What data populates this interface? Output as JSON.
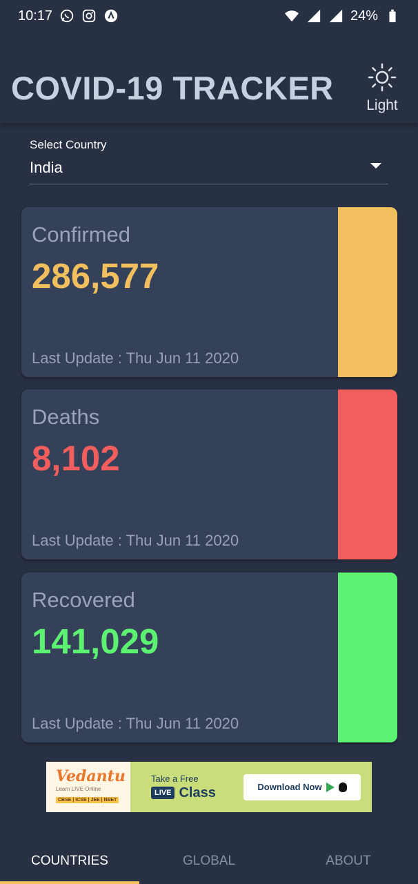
{
  "status_bar": {
    "time": "10:17",
    "battery": "24%",
    "icons_left": [
      "whatsapp-icon",
      "instagram-icon",
      "app-icon"
    ],
    "icons_right": [
      "wifi-icon",
      "signal-icon",
      "signal-roaming-icon",
      "battery-icon"
    ]
  },
  "header": {
    "title": "COVID-19 TRACKER",
    "theme_toggle": {
      "icon": "sun-icon",
      "label": "Light"
    }
  },
  "country_select": {
    "label": "Select Country",
    "value": "India"
  },
  "cards": [
    {
      "title": "Confirmed",
      "value": "286,577",
      "update": "Last Update : Thu Jun 11 2020",
      "color": "#f2bf5e"
    },
    {
      "title": "Deaths",
      "value": "8,102",
      "update": "Last Update : Thu Jun 11 2020",
      "color": "#f25d5d"
    },
    {
      "title": "Recovered",
      "value": "141,029",
      "update": "Last Update : Thu Jun 11 2020",
      "color": "#5ef272"
    }
  ],
  "ad": {
    "brand": "Vedantu",
    "tagline": "Learn LIVE Online",
    "boards": "CBSE | ICSE | JEE | NEET",
    "take_free": "Take a Free",
    "live": "LIVE",
    "class_text": "Class",
    "download": "Download Now"
  },
  "bottom_nav": {
    "tabs": [
      "COUNTRIES",
      "GLOBAL",
      "ABOUT"
    ],
    "active": "COUNTRIES",
    "accent": "#f4be5f"
  },
  "colors": {
    "background": "#283044",
    "card": "#354059",
    "title": "#c7d0e0"
  }
}
